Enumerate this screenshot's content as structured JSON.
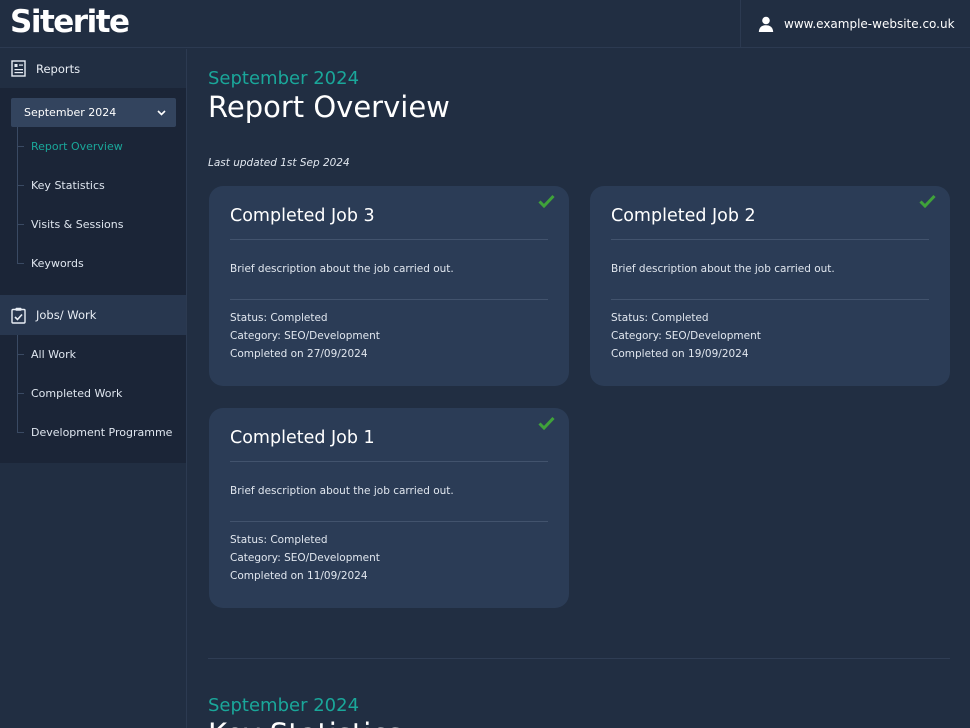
{
  "header": {
    "logo": "Siterite",
    "site": "www.example-website.co.uk"
  },
  "sidebar": {
    "reports_label": "Reports",
    "period_select": "September 2024",
    "report_items": [
      {
        "label": "Report Overview",
        "active": true
      },
      {
        "label": "Key Statistics"
      },
      {
        "label": "Visits & Sessions"
      },
      {
        "label": "Keywords"
      }
    ],
    "jobs_label": "Jobs/ Work",
    "job_items": [
      {
        "label": "All Work"
      },
      {
        "label": "Completed Work"
      },
      {
        "label": "Development Programme"
      }
    ]
  },
  "main": {
    "month": "September 2024",
    "title": "Report Overview",
    "last_updated": "Last updated 1st Sep 2024",
    "cards": [
      {
        "title": "Completed Job 3",
        "description": "Brief description about the job carried out.",
        "status": "Status: Completed",
        "category": "Category: SEO/Development",
        "completed": "Completed on 27/09/2024"
      },
      {
        "title": "Completed Job 2",
        "description": "Brief description about the job carried out.",
        "status": "Status: Completed",
        "category": "Category: SEO/Development",
        "completed": "Completed on 19/09/2024"
      },
      {
        "title": "Completed Job 1",
        "description": "Brief description about the job carried out.",
        "status": "Status: Completed",
        "category": "Category: SEO/Development",
        "completed": "Completed on 11/09/2024"
      }
    ],
    "next_section": {
      "month": "September 2024",
      "title": "Key Statistics"
    }
  },
  "colors": {
    "background": "#212e42",
    "accent": "#1aa79a",
    "card": "#2b3c56",
    "check": "#3fa23a"
  },
  "icons": [
    "user-icon",
    "report-icon",
    "clipboard-check-icon",
    "chevron-down-icon",
    "checkmark-icon"
  ]
}
